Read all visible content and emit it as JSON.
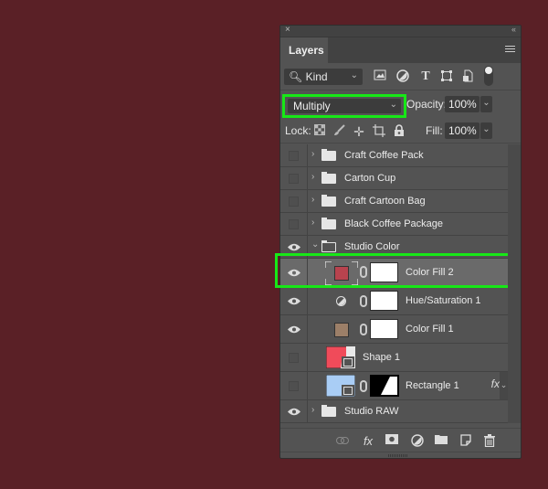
{
  "panel": {
    "title": "Layers",
    "close_glyph": "×",
    "collapse_glyph": "‹‹",
    "menu_icon": "hamburger-icon"
  },
  "filter": {
    "kind_label": "Kind",
    "icons": [
      "pixel-layer-filter-icon",
      "adjustment-layer-filter-icon",
      "type-layer-filter-icon",
      "shape-layer-filter-icon",
      "smart-object-filter-icon"
    ],
    "filter_toggle": "on"
  },
  "blend": {
    "mode": "Multiply",
    "opacity_label": "Opacity:",
    "opacity_value": "100%",
    "fill_label": "Fill:",
    "fill_value": "100%"
  },
  "lock": {
    "label": "Lock:",
    "icons": [
      "lock-transparent-pixels-icon",
      "lock-image-pixels-icon",
      "lock-position-icon",
      "lock-artboard-icon",
      "lock-all-icon"
    ]
  },
  "layers": [
    {
      "name": "Craft Coffee Pack",
      "type": "group",
      "visible": false,
      "expanded": false
    },
    {
      "name": "Carton Cup",
      "type": "group",
      "visible": false,
      "expanded": false
    },
    {
      "name": "Craft Cartoon Bag",
      "type": "group",
      "visible": false,
      "expanded": false
    },
    {
      "name": "Black Coffee Package",
      "type": "group",
      "visible": false,
      "expanded": false
    },
    {
      "name": "Studio Color",
      "type": "group",
      "visible": true,
      "expanded": true
    },
    {
      "name": "Color Fill 2",
      "type": "fill",
      "visible": true,
      "selected": true,
      "color": "#b8434e"
    },
    {
      "name": "Hue/Saturation 1",
      "type": "adjustment",
      "visible": true
    },
    {
      "name": "Color Fill 1",
      "type": "fill",
      "visible": true,
      "color": "#9c7f68"
    },
    {
      "name": "Shape 1",
      "type": "shape",
      "visible": false,
      "color": "#f04b5a"
    },
    {
      "name": "Rectangle 1",
      "type": "shape",
      "visible": false,
      "color": "#a9cdf5",
      "has_fx": true,
      "fx_label": "fx"
    },
    {
      "name": "Studio RAW",
      "type": "group",
      "visible": true,
      "expanded": false
    }
  ],
  "footer": {
    "icons": [
      "link-layers-icon",
      "layer-style-fx-icon",
      "add-mask-icon",
      "new-adjustment-layer-icon",
      "new-group-icon",
      "new-layer-icon",
      "delete-layer-icon"
    ]
  },
  "colors": {
    "background": "#5a2026",
    "highlight": "#17e817"
  }
}
